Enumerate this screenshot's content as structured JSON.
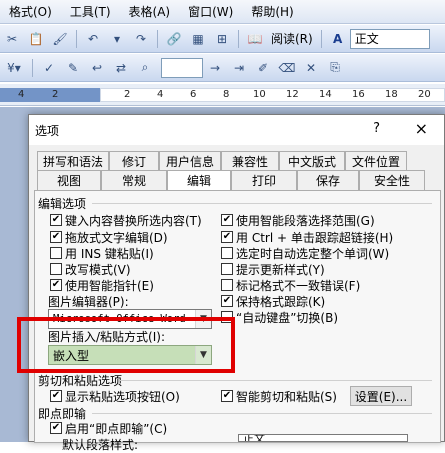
{
  "menubar": {
    "items": [
      "格式(O)",
      "工具(T)",
      "表格(A)",
      "窗口(W)",
      "帮助(H)"
    ]
  },
  "toolbar1": {
    "read_label": "阅读(R)",
    "style_value": "正文"
  },
  "ruler": {
    "numbers": [
      "4",
      "2",
      "2",
      "4",
      "6",
      "8",
      "10",
      "12",
      "14",
      "16",
      "18",
      "20"
    ]
  },
  "dialog": {
    "title": "选项",
    "help": "?",
    "close": "×",
    "tabs_row1": [
      "拼写和语法",
      "修订",
      "用户信息",
      "兼容性",
      "中文版式",
      "文件位置"
    ],
    "tabs_row2": [
      "视图",
      "常规",
      "编辑",
      "打印",
      "保存",
      "安全性"
    ],
    "active_tab": "编辑",
    "edit_section": {
      "title": "编辑选项",
      "left_options": [
        {
          "label": "键入内容替换所选内容(T)",
          "checked": true
        },
        {
          "label": "拖放式文字编辑(D)",
          "checked": true
        },
        {
          "label": "用 INS 键粘贴(I)",
          "checked": false
        },
        {
          "label": "改写模式(V)",
          "checked": false
        },
        {
          "label": "使用智能指针(E)",
          "checked": true
        }
      ],
      "right_options": [
        {
          "label": "使用智能段落选择范围(G)",
          "checked": true
        },
        {
          "label": "用 Ctrl + 单击跟踪超链接(H)",
          "checked": true
        },
        {
          "label": "选定时自动选定整个单词(W)",
          "checked": false
        },
        {
          "label": "提示更新样式(Y)",
          "checked": false
        },
        {
          "label": "标记格式不一致错误(F)",
          "checked": false
        },
        {
          "label": "保持格式跟踪(K)",
          "checked": true
        },
        {
          "label": "“自动键盘”切换(B)",
          "checked": false
        }
      ],
      "picture_editor_label": "图片编辑器(P):",
      "picture_editor_value": "Microsoft Office Word",
      "insert_paste_label": "图片插入/粘贴方式(I):",
      "insert_paste_value": "嵌入型"
    },
    "cut_paste_section": {
      "title": "剪切和粘贴选项",
      "show_paste_buttons": {
        "label": "显示粘贴选项按钮(O)",
        "checked": true
      },
      "smart_cut_paste": {
        "label": "智能剪切和粘贴(S)",
        "checked": true
      },
      "settings_button": "设置(E)..."
    },
    "click_type_section": {
      "title": "即点即输",
      "enable": {
        "label": "启用“即点即输”(C)",
        "checked": true
      },
      "default_para_label": "默认段落样式:",
      "default_para_value": "正文"
    }
  },
  "colors": {
    "highlight_border": "#e00000",
    "insert_combo_bg": "#c6dfb8",
    "ruler_blue": "#7394c7"
  }
}
